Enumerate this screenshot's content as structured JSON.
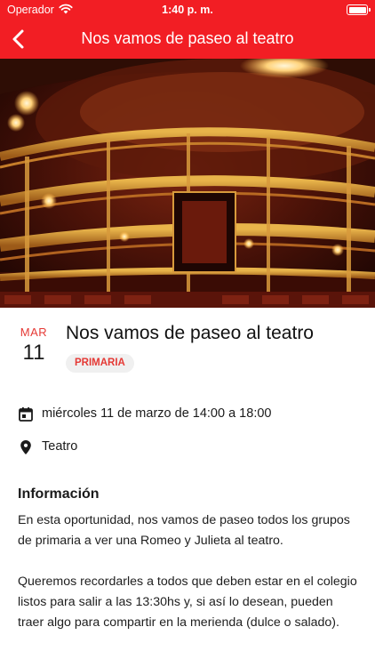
{
  "status_bar": {
    "carrier": "Operador",
    "time": "1:40 p. m."
  },
  "nav": {
    "title": "Nos vamos de paseo al teatro"
  },
  "event": {
    "month": "MAR",
    "day": "11",
    "title": "Nos vamos de paseo al teatro",
    "tag": "PRIMARIA",
    "datetime": "miércoles 11 de marzo de 14:00 a 18:00",
    "location": "Teatro"
  },
  "info": {
    "heading": "Información",
    "paragraphs": [
      "En esta oportunidad, nos vamos de paseo todos los grupos de primaria a ver una Romeo y Julieta al teatro.",
      "Queremos recordarles a todos que deben estar en el colegio listos para salir a las 13:30hs y, si así lo desean, pueden traer algo para compartir en la merienda (dulce o salado)."
    ]
  },
  "colors": {
    "accent": "#f21e24",
    "month_text": "#e53935",
    "chip_bg": "#f0f0f0"
  },
  "icons": {
    "back": "chevron-left-icon",
    "calendar": "calendar-icon",
    "location": "location-pin-icon"
  }
}
